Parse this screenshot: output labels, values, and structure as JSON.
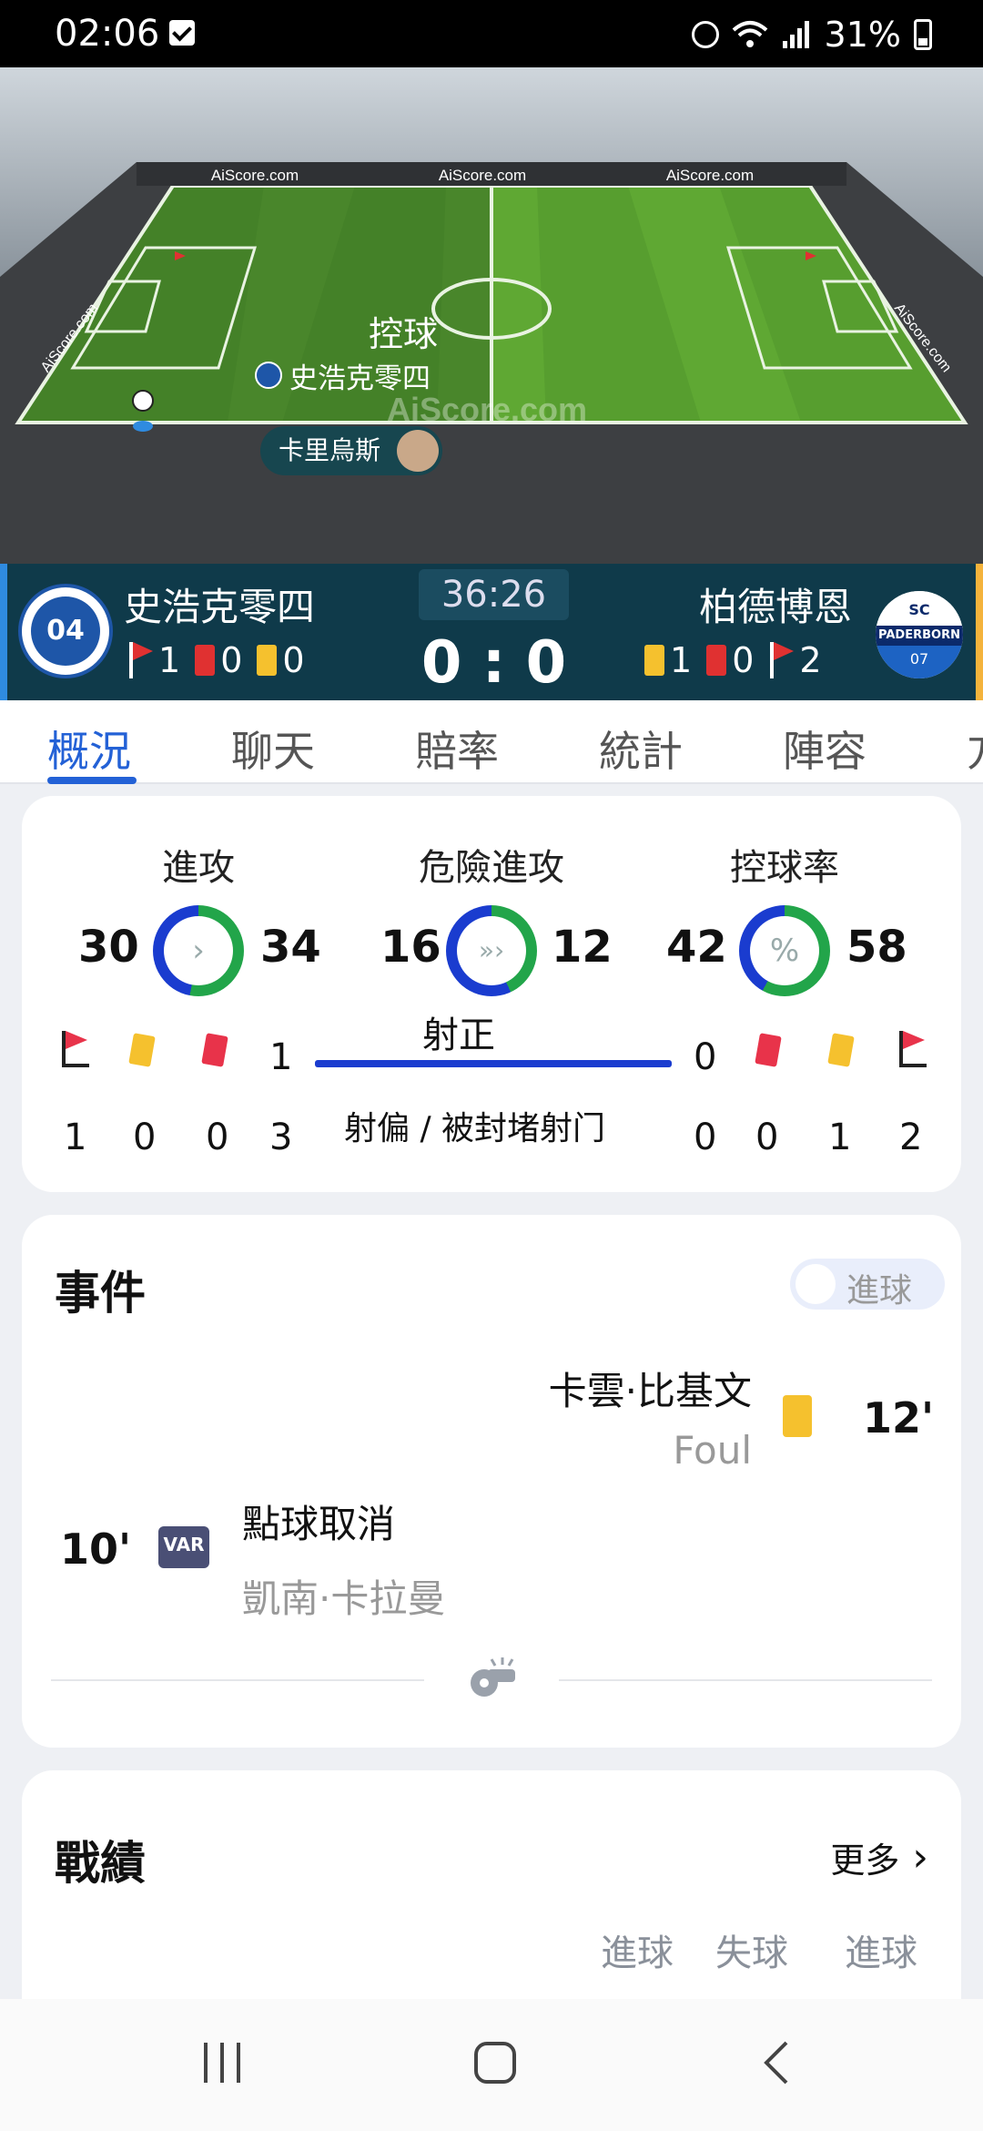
{
  "status_bar": {
    "time": "02:06",
    "battery": "31%"
  },
  "pitch": {
    "watermark": "AiScore.com",
    "banner_left": "AiScore.com",
    "banner_mid": "AiScore.com",
    "banner_right": "AiScore.com",
    "side_left": "AiScore.com",
    "side_right": "AiScore.com",
    "possession_label": "控球",
    "possession_team": "史浩克零四",
    "player_name": "卡里烏斯"
  },
  "scoreboard": {
    "home": {
      "name": "史浩克零四",
      "logo_text": "04",
      "corners": "1",
      "red": "0",
      "yellow": "0"
    },
    "away": {
      "name": "柏德博恩",
      "logo_text": "PADERBORN",
      "logo_top": "SC",
      "logo_bottom": "07",
      "yellow": "1",
      "red": "0",
      "corners": "2"
    },
    "clock": "36:26",
    "score": "0 : 0"
  },
  "tabs": [
    "概況",
    "聊天",
    "賠率",
    "統計",
    "陣容",
    "方"
  ],
  "stats": {
    "attack": {
      "label": "進攻",
      "home": "30",
      "away": "34",
      "home_share": 0.47
    },
    "dangerous": {
      "label": "危險進攻",
      "home": "16",
      "away": "12",
      "home_share": 0.57
    },
    "possession": {
      "label": "控球率",
      "home": "42",
      "away": "58",
      "home_share": 0.42
    },
    "shots_on_target": {
      "label": "射正",
      "home": "1",
      "away": "0"
    },
    "shots_off": {
      "label": "射偏 / 被封堵射门"
    },
    "home_row": {
      "corners": "1",
      "yellow": "0",
      "red": "0",
      "shots_off": "3"
    },
    "away_row": {
      "shots_off": "0",
      "red": "0",
      "yellow": "1",
      "corners": "2"
    }
  },
  "events": {
    "title": "事件",
    "toggle_label": "進球",
    "items": [
      {
        "minute": "12'",
        "player": "卡雲·比基文",
        "detail": "Foul"
      },
      {
        "minute": "10'",
        "badge": "VAR",
        "player": "點球取消",
        "detail": "凱南·卡拉曼"
      }
    ]
  },
  "record": {
    "title": "戰績",
    "more": "更多",
    "cols": [
      "進球",
      "失球",
      "進球"
    ]
  },
  "colors": {
    "accent": "#2361d6",
    "home_ring": "#1a3ccf",
    "away_ring": "#22a54a"
  }
}
